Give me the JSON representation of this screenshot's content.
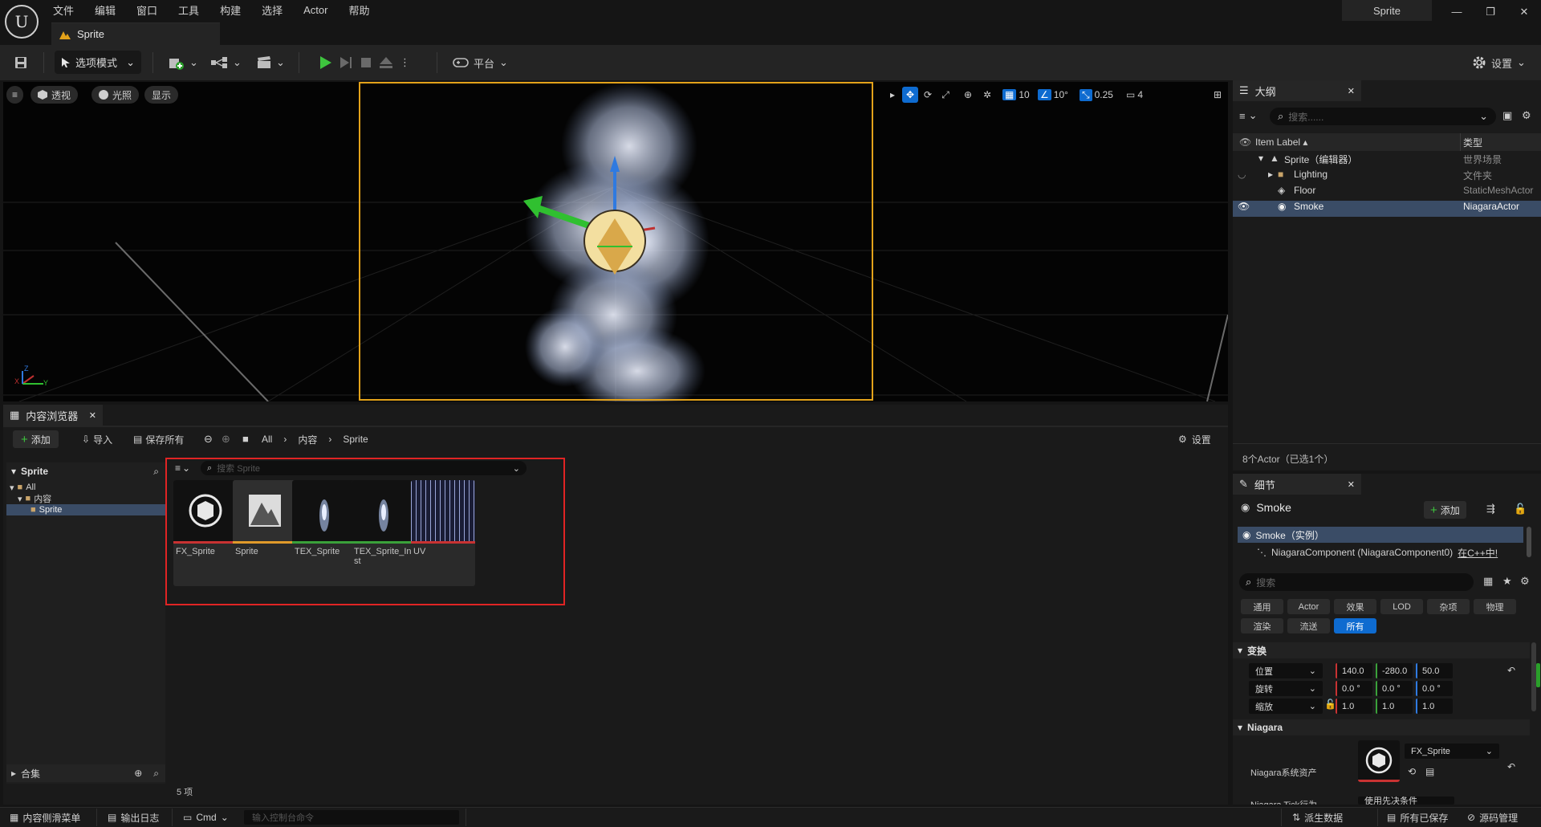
{
  "app": {
    "menu": [
      "文件",
      "编辑",
      "窗口",
      "工具",
      "构建",
      "选择",
      "Actor",
      "帮助"
    ],
    "doc_tab": "Sprite",
    "window_title": "Sprite",
    "window_buttons": [
      "—",
      "❐",
      "✕"
    ]
  },
  "toolbar": {
    "mode_label": "选项模式",
    "platform_label": "平台",
    "settings_label": "设置"
  },
  "viewport": {
    "hamburger_icon": "≡",
    "perspective": "透视",
    "lighting": "光照",
    "show": "显示",
    "grid_snap": "10",
    "rotation_snap": "10°",
    "scale_snap": "0.25",
    "camera_speed": "4",
    "axis_x": "X",
    "axis_y": "Y",
    "axis_z": "Z"
  },
  "outliner": {
    "tab_title": "大纲",
    "search_placeholder": "搜索......",
    "col_label": "Item Label ▴",
    "col_type": "类型",
    "rows": [
      {
        "label": "Sprite（编辑器）",
        "type": "世界场景"
      },
      {
        "label": "Lighting",
        "type": "文件夹"
      },
      {
        "label": "Floor",
        "type": "StaticMeshActor"
      },
      {
        "label": "Smoke",
        "type": "NiagaraActor"
      }
    ],
    "summary": "8个Actor（已选1个）"
  },
  "details": {
    "tab_title": "细节",
    "actor_name": "Smoke",
    "add_label": "添加",
    "instance_label": "Smoke（实例）",
    "component_label": "NiagaraComponent (NiagaraComponent0)",
    "component_link": "在C++中!",
    "search_placeholder": "搜索",
    "filters": [
      "通用",
      "Actor",
      "效果",
      "LOD",
      "杂项",
      "物理",
      "渲染",
      "流送",
      "所有"
    ],
    "section_transform": "变换",
    "transform": [
      {
        "label": "位置",
        "values": [
          "140.0",
          "-280.0",
          "50.0"
        ]
      },
      {
        "label": "旋转",
        "values": [
          "0.0 °",
          "0.0 °",
          "0.0 °"
        ]
      },
      {
        "label": "缩放",
        "values": [
          "1.0",
          "1.0",
          "1.0"
        ]
      }
    ],
    "section_niagara": "Niagara",
    "niagara_asset_label": "Niagara系统资产",
    "niagara_asset_value": "FX_Sprite",
    "niagara_tick_label": "Niagara Tick行为",
    "niagara_tick_value": "使用先决条件"
  },
  "content_browser": {
    "tab_title": "内容浏览器",
    "add_label": "添加",
    "import_label": "导入",
    "save_all_label": "保存所有",
    "breadcrumb": [
      "All",
      "内容",
      "Sprite"
    ],
    "settings_label": "设置",
    "tree_header": "Sprite",
    "tree": [
      "All",
      "内容",
      "Sprite"
    ],
    "collections_label": "合集",
    "search_placeholder": "搜索 Sprite",
    "item_count": "5 项",
    "assets": [
      {
        "name": "FX_Sprite",
        "bar_color": "#c83232"
      },
      {
        "name": "Sprite",
        "bar_color": "#e09a2a"
      },
      {
        "name": "TEX_Sprite",
        "bar_color": "#3aa13a"
      },
      {
        "name": "TEX_Sprite_Inst",
        "bar_color": "#3aa13a"
      },
      {
        "name": "UV",
        "bar_color": "#c83232"
      }
    ]
  },
  "statusbar": {
    "drawer": "内容侧滑菜单",
    "output_log": "输出日志",
    "cmd": "Cmd",
    "console_placeholder": "输入控制台命令",
    "derived_data": "派生数据",
    "all_saved": "所有已保存",
    "source_control": "源码管理"
  }
}
